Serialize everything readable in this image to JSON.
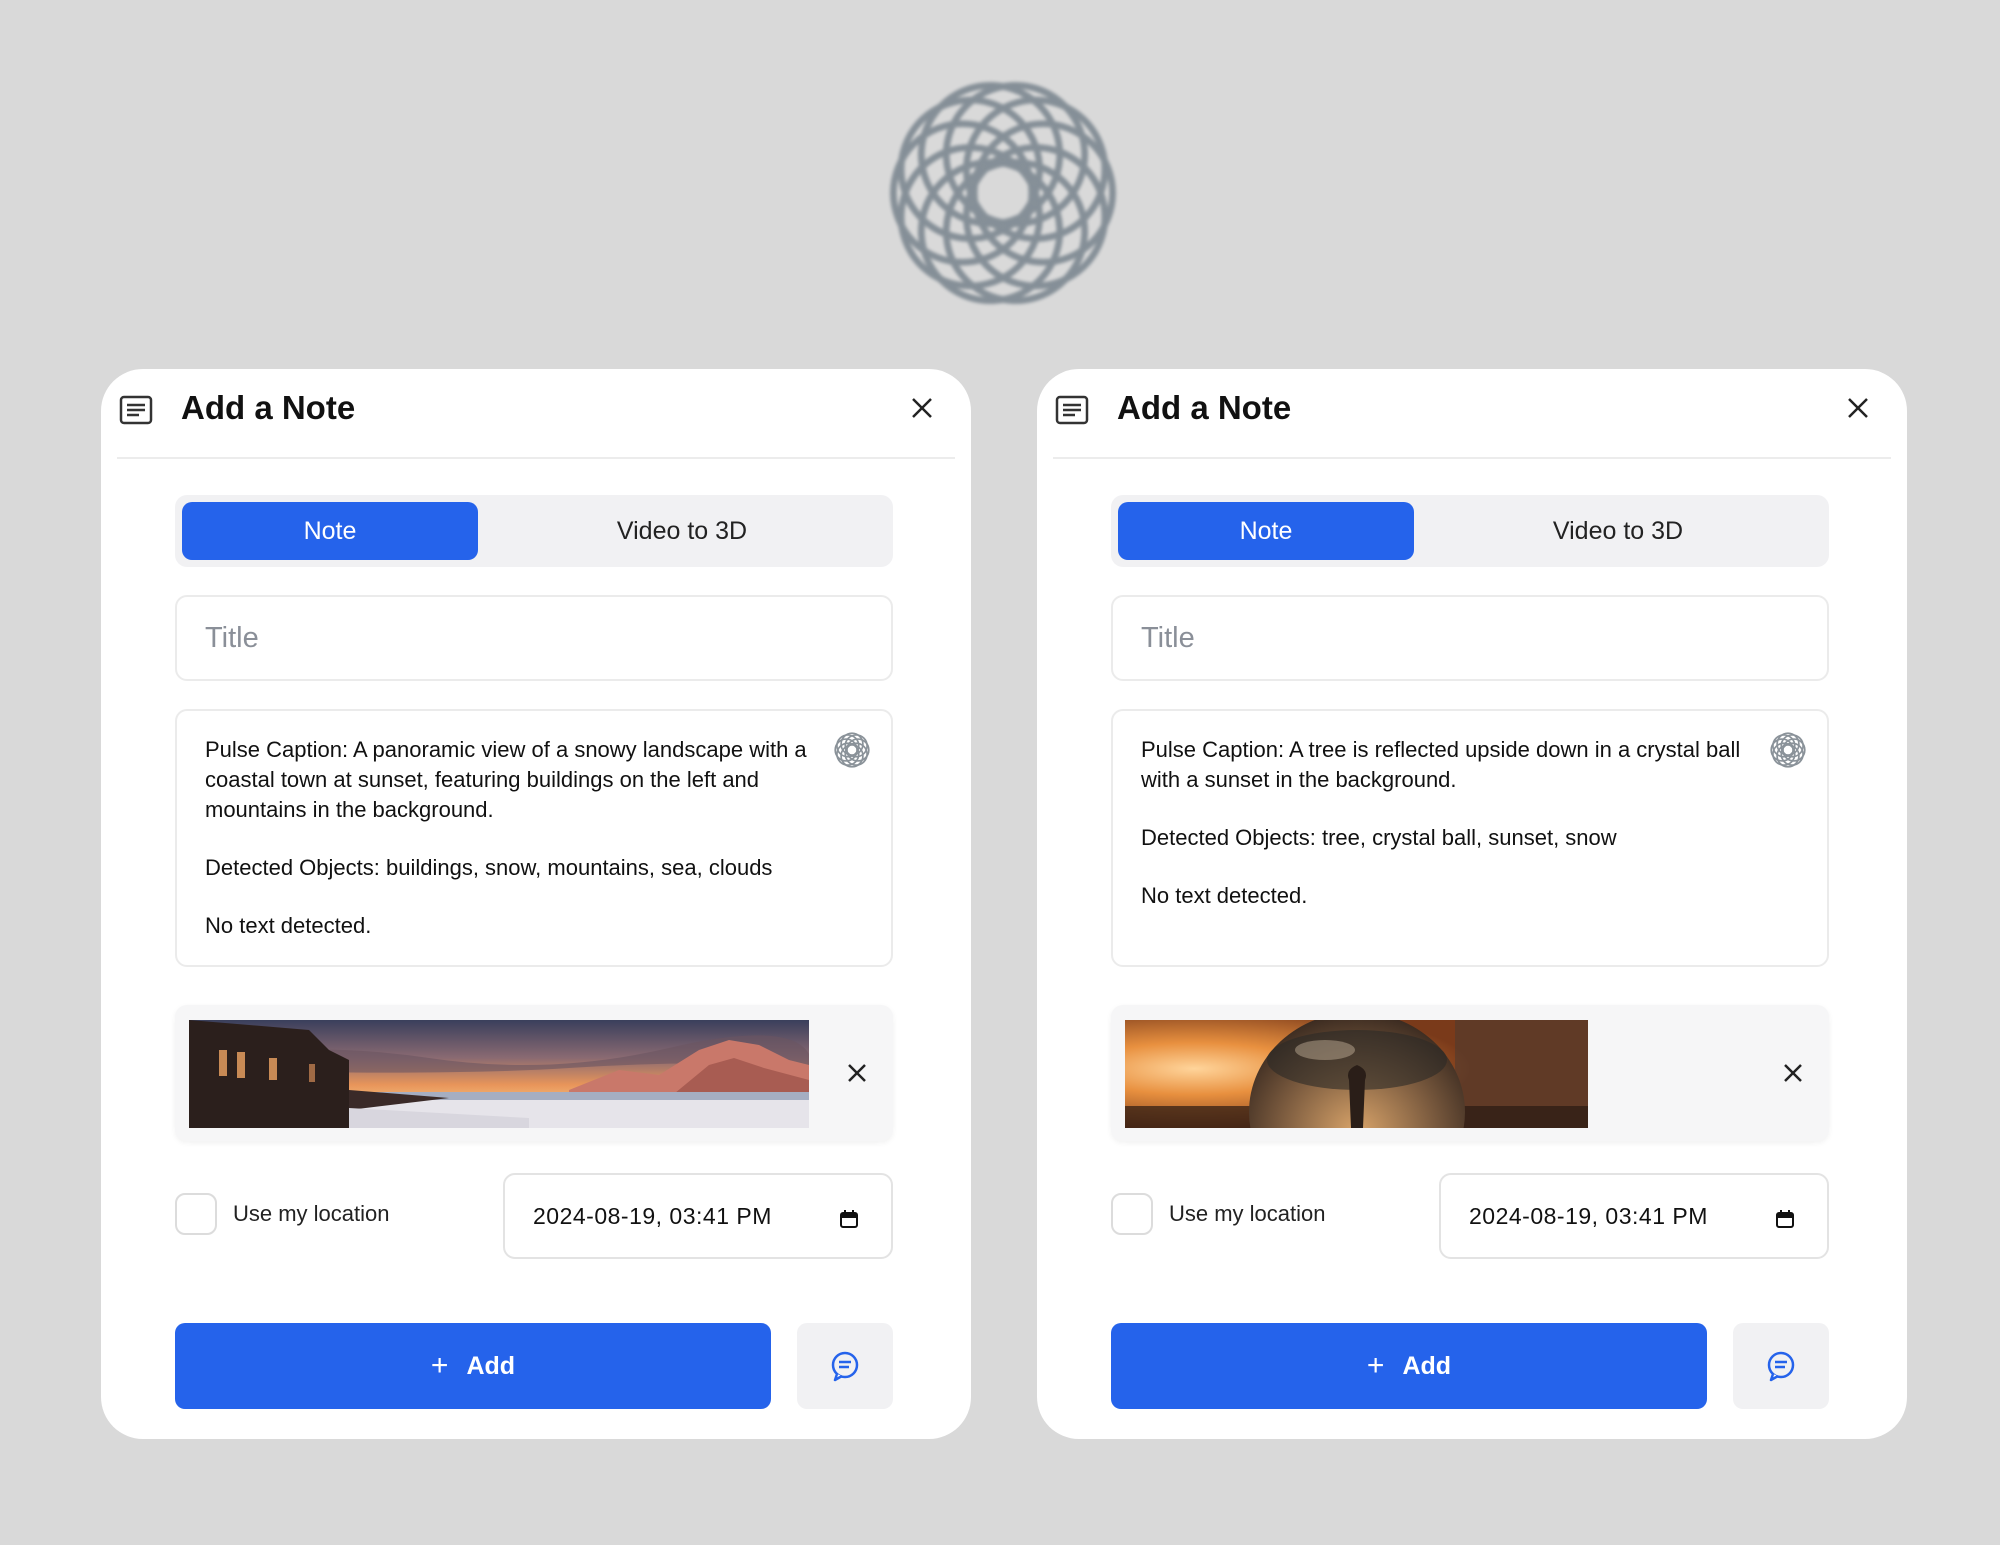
{
  "colors": {
    "accent": "#2563eb",
    "background": "#d9d9d9",
    "card": "#ffffff"
  },
  "logo": {
    "icon": "swirl-flower-logo-icon"
  },
  "dialogs": [
    {
      "header": {
        "title": "Add a Note",
        "icon": "note-icon",
        "close_icon": "close-icon"
      },
      "tabs": [
        {
          "label": "Note",
          "active": true
        },
        {
          "label": "Video to 3D",
          "active": false
        }
      ],
      "title_field": {
        "placeholder": "Title",
        "value": ""
      },
      "caption": {
        "pulse_caption": "Pulse Caption: A panoramic view of a snowy landscape with a coastal town at sunset, featuring buildings on the left and mountains in the background.",
        "detected_objects": "Detected Objects: buildings, snow, mountains, sea, clouds",
        "text_detected": "No text detected."
      },
      "attachment": {
        "image": "snowy-coastal-panorama",
        "remove_icon": "close-icon"
      },
      "location": {
        "label": "Use my location",
        "checked": false
      },
      "datetime": {
        "value": "2024-08-19, 03:41 PM",
        "icon": "calendar-icon"
      },
      "actions": {
        "add_label": "Add",
        "add_icon": "plus-icon",
        "chat_icon": "chat-bubble-icon"
      }
    },
    {
      "header": {
        "title": "Add a Note",
        "icon": "note-icon",
        "close_icon": "close-icon"
      },
      "tabs": [
        {
          "label": "Note",
          "active": true
        },
        {
          "label": "Video to 3D",
          "active": false
        }
      ],
      "title_field": {
        "placeholder": "Title",
        "value": ""
      },
      "caption": {
        "pulse_caption": "Pulse Caption: A tree is reflected upside down in a crystal ball with a sunset in the background.",
        "detected_objects": "Detected Objects: tree, crystal ball, sunset, snow",
        "text_detected": "No text detected."
      },
      "attachment": {
        "image": "crystal-ball-sunset",
        "remove_icon": "close-icon"
      },
      "location": {
        "label": "Use my location",
        "checked": false
      },
      "datetime": {
        "value": "2024-08-19, 03:41 PM",
        "icon": "calendar-icon"
      },
      "actions": {
        "add_label": "Add",
        "add_icon": "plus-icon",
        "chat_icon": "chat-bubble-icon"
      }
    }
  ]
}
